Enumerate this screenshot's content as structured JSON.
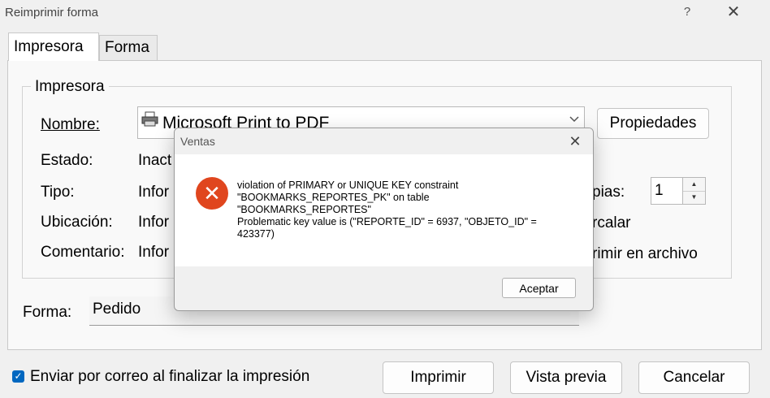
{
  "window": {
    "title": "Reimprimir forma",
    "help_glyph": "?",
    "close_glyph": "✕"
  },
  "tabs": [
    {
      "label": "Impresora",
      "active": true
    },
    {
      "label": "Forma",
      "active": false
    }
  ],
  "printer_group": {
    "legend": "Impresora",
    "name_label": "Nombre:",
    "name_value": "Microsoft Print to PDF",
    "properties_button": "Propiedades",
    "status_label": "Estado:",
    "status_value": "Inact",
    "type_label": "Tipo:",
    "type_value": "Infor",
    "location_label": "Ubicación:",
    "location_value": "Infor",
    "comment_label": "Comentario:",
    "comment_value": "Infor",
    "copies_label": "pias:",
    "copies_value": "1",
    "collate_label": "rcalar",
    "print_to_file_label": "rimir en archivo"
  },
  "form_field": {
    "label": "Forma:",
    "value": "Pedido"
  },
  "email_checkbox": {
    "checked": true,
    "label": "Enviar por correo al finalizar la impresión"
  },
  "buttons": {
    "print": "Imprimir",
    "preview": "Vista previa",
    "cancel": "Cancelar"
  },
  "error_dialog": {
    "title": "Ventas",
    "close_glyph": "✕",
    "icon_glyph": "✕",
    "message": "violation of PRIMARY or UNIQUE KEY constraint\n\"BOOKMARKS_REPORTES_PK\" on table\n\"BOOKMARKS_REPORTES\"\nProblematic key value is (\"REPORTE_ID\" = 6937, \"OBJETO_ID\" =\n423377)",
    "ok_button": "Aceptar",
    "icon_color": "#e0461e"
  }
}
